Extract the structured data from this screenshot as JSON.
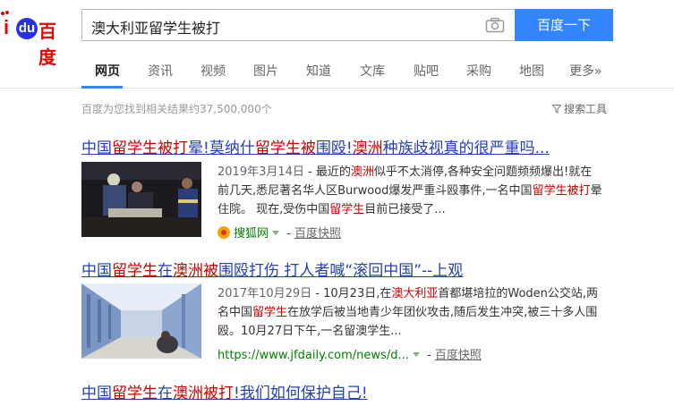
{
  "logo": {
    "mark": "Bai",
    "du": "du",
    "brand": "百度"
  },
  "search": {
    "query": "澳大利亚留学生被打",
    "button_label": "百度一下"
  },
  "nav": {
    "items": [
      {
        "label": "网页",
        "active": true
      },
      {
        "label": "资讯"
      },
      {
        "label": "视频"
      },
      {
        "label": "图片"
      },
      {
        "label": "知道"
      },
      {
        "label": "文库"
      },
      {
        "label": "贴吧"
      },
      {
        "label": "采购"
      },
      {
        "label": "地图"
      },
      {
        "label": "更多»"
      }
    ]
  },
  "stats": "百度为您找到相关结果约37,500,000个",
  "tools_label": "搜索工具",
  "results": [
    {
      "title_parts": [
        "中国",
        "留学生",
        "被打",
        "晕!莫纳什",
        "留学生",
        "被",
        "围殴!",
        "澳洲",
        "种族歧视真的很严重吗..."
      ],
      "date": "2019年3月14日",
      "desc": " - 最近的澳洲似乎不太消停,各种安全问题频频爆出!就在前几天,悉尼著名华人区Burwood爆发严重斗殴事件,一名中国留学生被打晕住院。 现在,受伤中国留学生目前已接受了...",
      "source": "搜狐网",
      "cache": "百度快照"
    },
    {
      "title_parts": [
        "中国",
        "留学生",
        "在",
        "澳洲",
        "被",
        "围殴打伤 打人者喊“滚回中国”--上观"
      ],
      "date": "2017年10月29日",
      "desc": " - 10月23日,在澳大利亚首都堪培拉的Woden公交站,两名中国留学生在放学后被当地青少年团伙攻击,随后发生冲突,被三十多人围殴。10月27日下午,一名留澳学生...",
      "source": "https://www.jfdaily.com/news/d...",
      "cache": "百度快照"
    },
    {
      "title_parts": [
        "中国",
        "留学生",
        "在",
        "澳洲",
        "被打",
        "!我们如何保护自己!"
      ]
    }
  ],
  "colors": {
    "link": "#2440b3",
    "highlight": "#cc0000",
    "button": "#3385ff",
    "site": "#008000"
  }
}
